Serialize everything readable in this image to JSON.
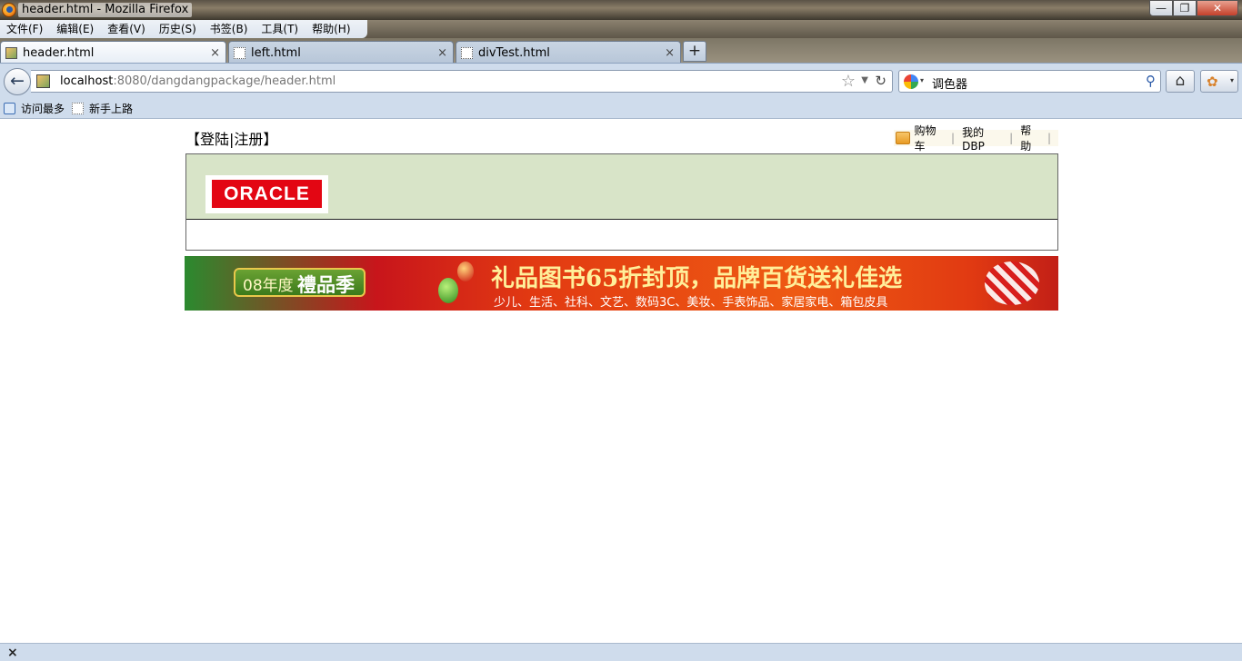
{
  "window": {
    "title": "header.html - Mozilla Firefox",
    "minimize": "—",
    "maximize": "❐",
    "close": "✕"
  },
  "menu": [
    "文件(F)",
    "编辑(E)",
    "查看(V)",
    "历史(S)",
    "书签(B)",
    "工具(T)",
    "帮助(H)"
  ],
  "tabs": [
    {
      "label": "header.html",
      "close": "×",
      "active": true
    },
    {
      "label": "left.html",
      "close": "×",
      "active": false
    },
    {
      "label": "divTest.html",
      "close": "×",
      "active": false
    }
  ],
  "new_tab": "+",
  "nav": {
    "back": "←",
    "url_host": "localhost",
    "url_rest": ":8080/dangdangpackage/header.html",
    "bookmark_star": "☆",
    "dropmarker": "▼",
    "reload": "↻",
    "search_text": "调色器",
    "search_dropdown": "▾",
    "search_go": "⚲",
    "home": "⌂",
    "addon": "✿",
    "addon_caret": "▾"
  },
  "bookmarks": [
    "访问最多",
    "新手上路"
  ],
  "page": {
    "login_links": "【登陆|注册】",
    "toplinks": {
      "cart": "购物车",
      "account": "我的DBP",
      "help": "帮助",
      "separator": "|"
    },
    "logo_text": "ORACLE",
    "banner": {
      "year_label": "08年度",
      "season_label": "禮品季",
      "headline": "礼品图书65折封顶，品牌百货送礼佳选",
      "subline": "少儿、生活、社科、文艺、数码3C、美妆、手表饰品、家居家电、箱包皮具"
    }
  },
  "status": {
    "close": "×"
  }
}
